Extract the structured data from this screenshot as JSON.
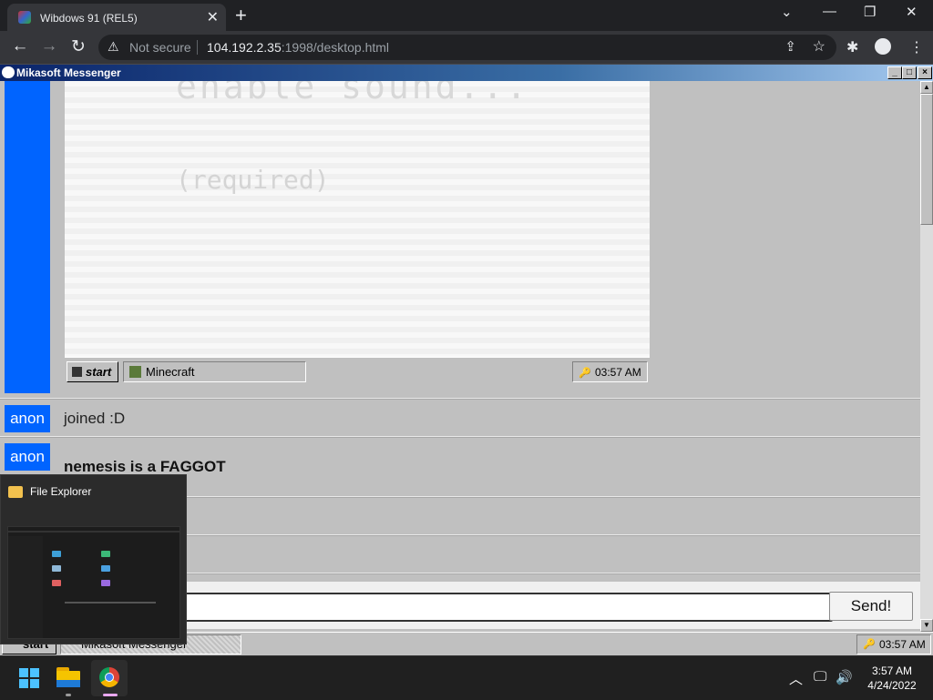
{
  "browser": {
    "tab_title": "Wibdows 91 (REL5)",
    "security_label": "Not secure",
    "url_host": "104.192.2.35",
    "url_path": ":1998/desktop.html"
  },
  "window": {
    "title": "Mikasoft Messenger"
  },
  "embedded_screen": {
    "big_text": "enable sound...",
    "sub_text": "(required)",
    "start_label": "start",
    "app_label": "Minecraft",
    "clock": "03:57 AM"
  },
  "messages": [
    {
      "user": "anon",
      "text": "joined :D"
    },
    {
      "user": "anon",
      "text": "nemesis is a FAGGOT"
    }
  ],
  "composer": {
    "send_label": "Send!",
    "value": ""
  },
  "wibdows_taskbar": {
    "start_label": "start",
    "app_label": "Mikasoft Messenger",
    "clock": "03:57 AM"
  },
  "explorer_popup": {
    "title": "File Explorer"
  },
  "os_taskbar": {
    "time": "3:57 AM",
    "date": "4/24/2022"
  },
  "colors": {
    "user_badge": "#0064ff",
    "titlebar": "#0a246a"
  }
}
